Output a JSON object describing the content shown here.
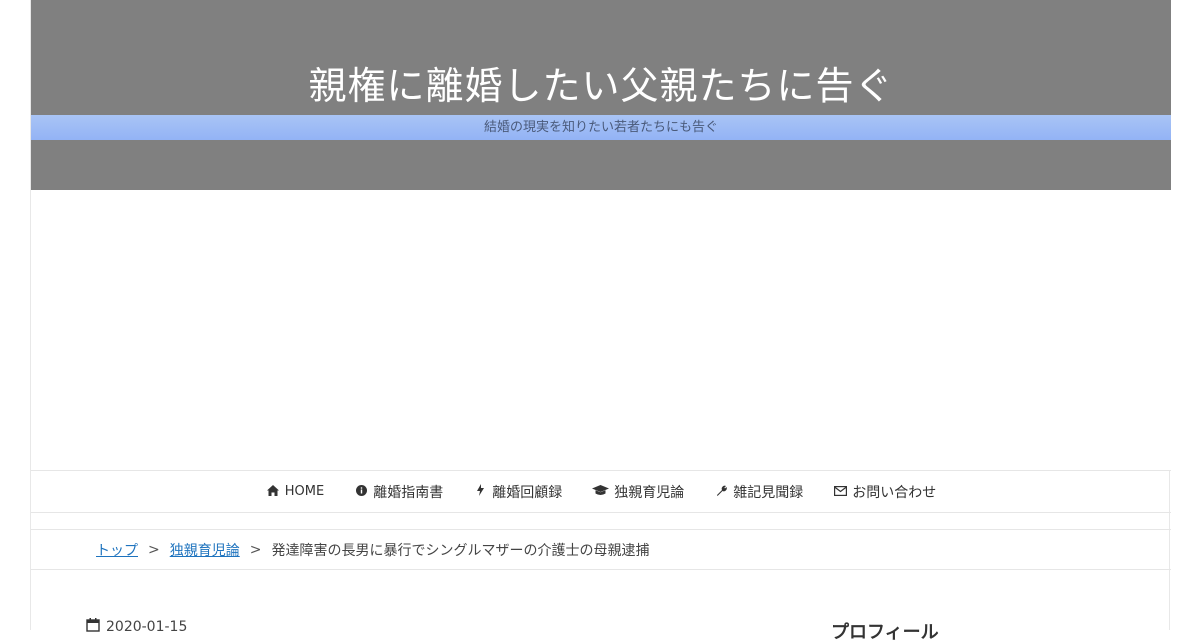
{
  "header": {
    "site_title": "親権に離婚したい父親たちに告ぐ",
    "tagline": "結婚の現実を知りたい若者たちにも告ぐ"
  },
  "nav": {
    "items": [
      {
        "label": "HOME",
        "icon": "home-icon"
      },
      {
        "label": "離婚指南書",
        "icon": "info-icon"
      },
      {
        "label": "離婚回顧録",
        "icon": "bolt-icon"
      },
      {
        "label": "独親育児論",
        "icon": "graduation-cap-icon"
      },
      {
        "label": "雑記見聞録",
        "icon": "wrench-icon"
      },
      {
        "label": "お問い合わせ",
        "icon": "envelope-icon"
      }
    ]
  },
  "breadcrumb": {
    "items": [
      "トップ",
      "独親育児論"
    ],
    "separator": ">",
    "current": "発達障害の長男に暴行でシングルマザーの介護士の母親逮捕"
  },
  "article": {
    "date": "2020-01-15"
  },
  "sidebar": {
    "heading": "プロフィール"
  },
  "colors": {
    "header_bg": "#808080",
    "tagline_band": "#a9c4f5",
    "link": "#1e73be"
  }
}
